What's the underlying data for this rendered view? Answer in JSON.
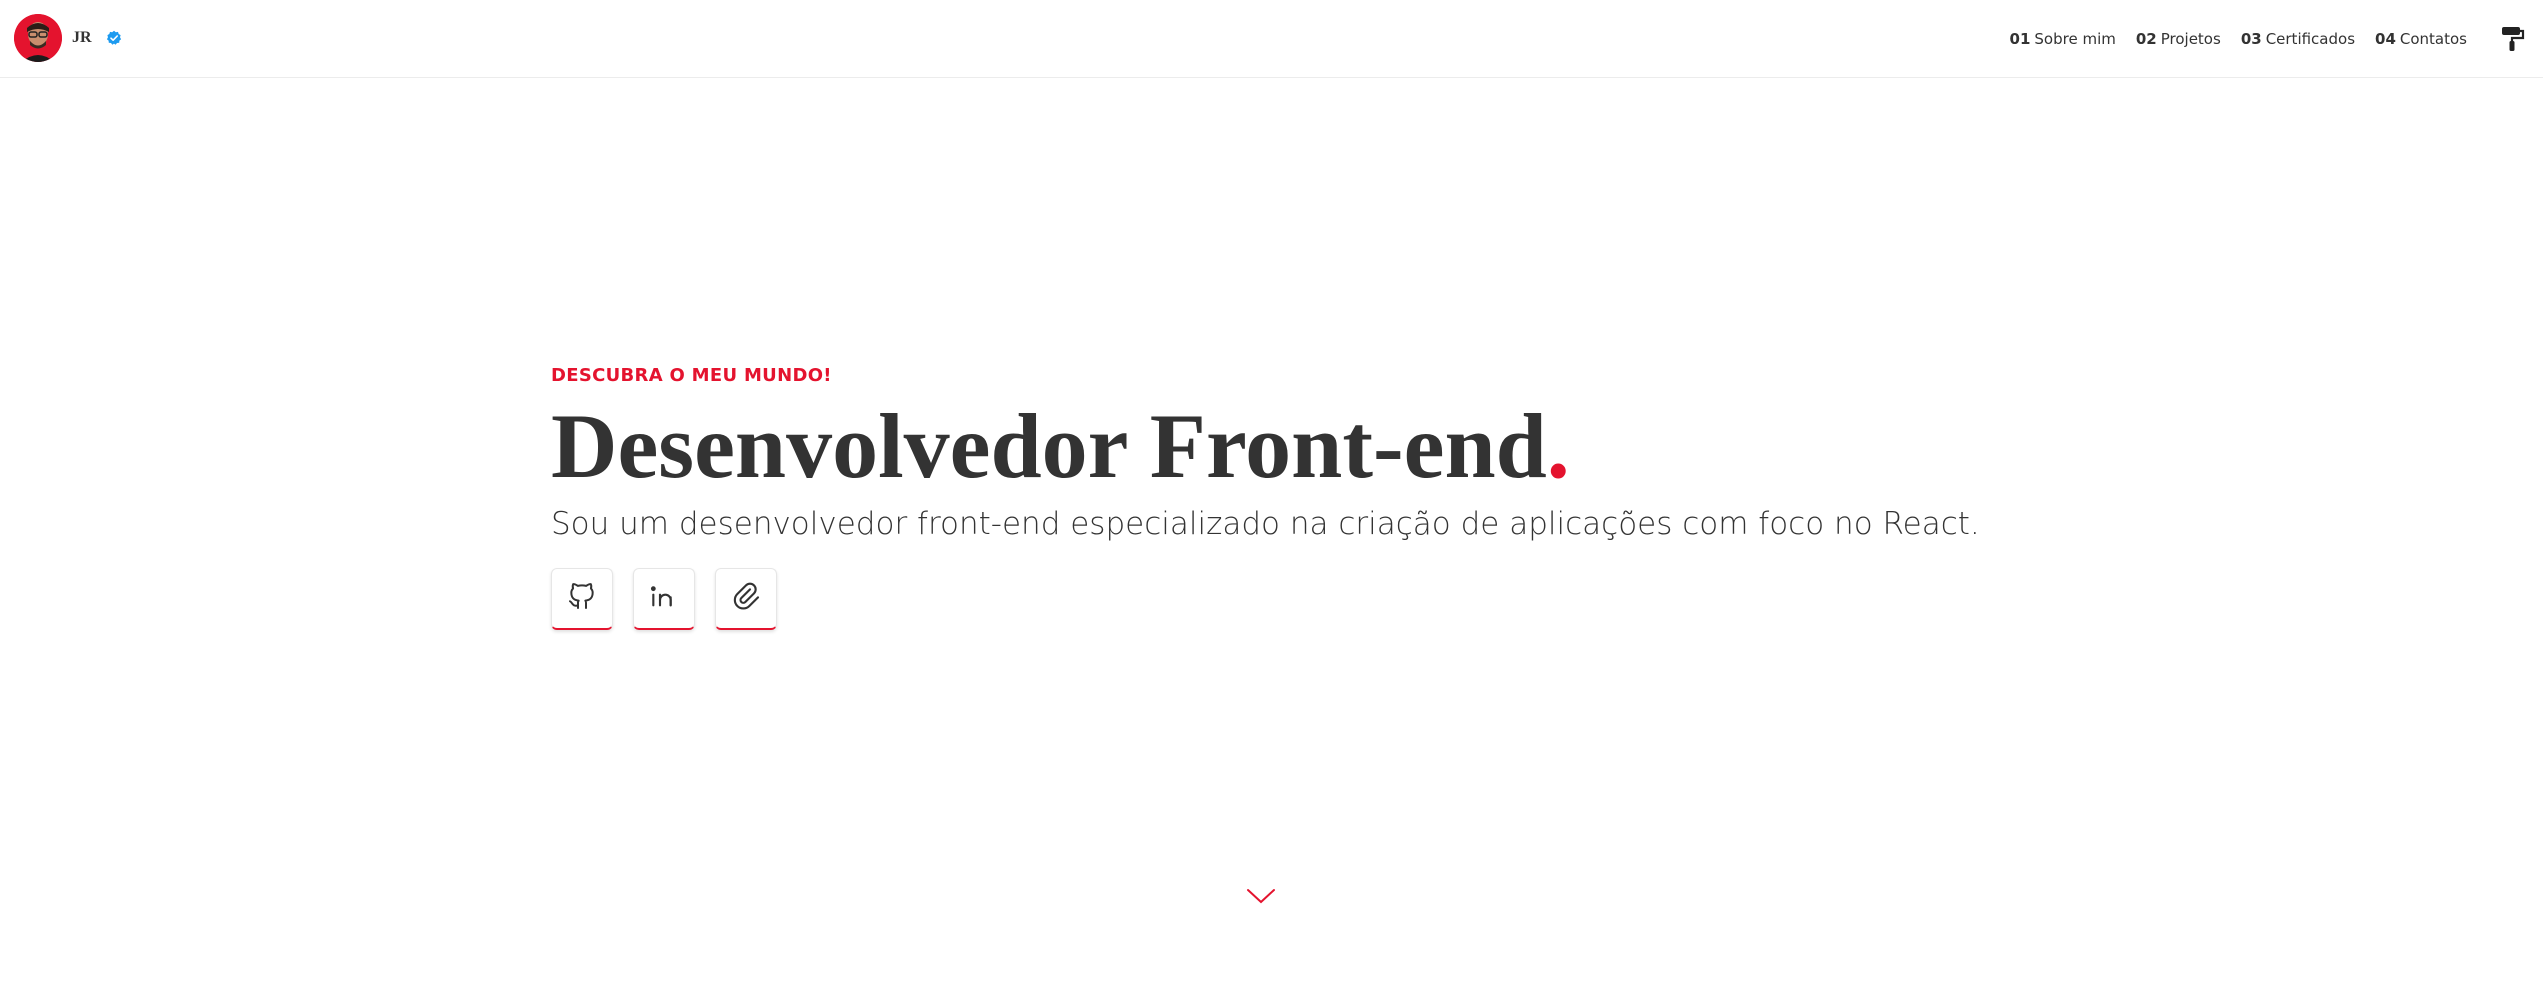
{
  "header": {
    "initials": "JR",
    "nav": [
      {
        "num": "01",
        "label": "Sobre mim"
      },
      {
        "num": "02",
        "label": "Projetos"
      },
      {
        "num": "03",
        "label": "Certificados"
      },
      {
        "num": "04",
        "label": "Contatos"
      }
    ],
    "theme_icon": "paint-roller-icon"
  },
  "hero": {
    "kicker": "DESCUBRA O MEU MUNDO!",
    "headline": "Desenvolvedor Front-end",
    "headline_dot": ".",
    "subtitle": "Sou um desenvolvedor front-end especializado na criação de aplicações com foco no React.",
    "socials": [
      {
        "icon": "github-icon"
      },
      {
        "icon": "linkedin-icon"
      },
      {
        "icon": "paperclip-icon"
      }
    ]
  },
  "scroll_icon": "chevron-down-icon",
  "colors": {
    "accent": "#e4132e",
    "text": "#333333",
    "verified": "#1d9bf0"
  }
}
